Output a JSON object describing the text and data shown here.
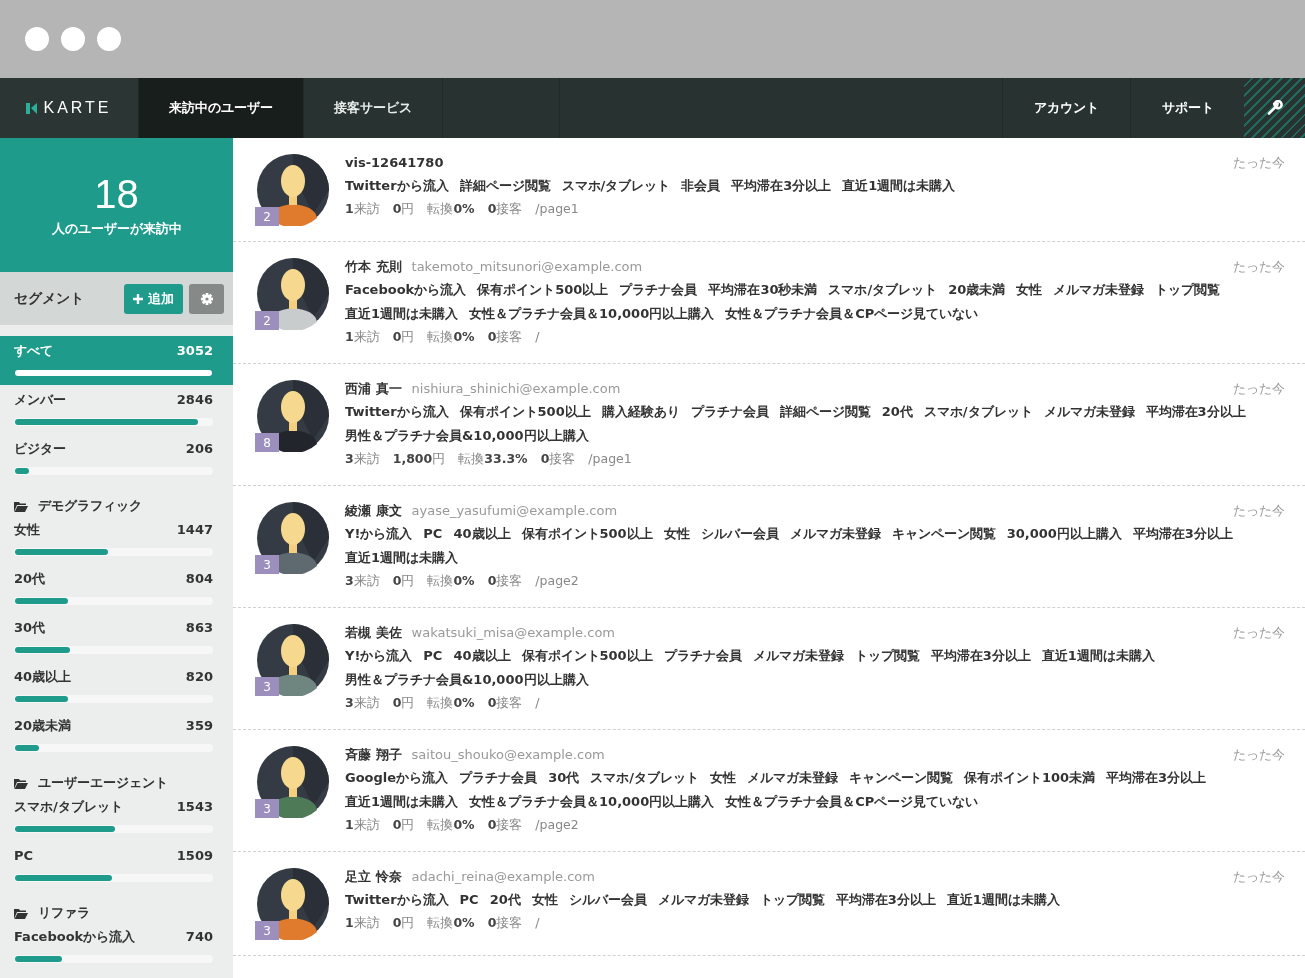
{
  "nav": {
    "logo": "KARTE",
    "tabs": [
      {
        "label": "来訪中のユーザー",
        "selected": true
      },
      {
        "label": "接客サービス",
        "selected": false
      }
    ],
    "right_links": [
      "アカウント",
      "サポート"
    ]
  },
  "summary": {
    "count": "18",
    "caption": "人のユーザーが来訪中"
  },
  "segments": {
    "title": "セグメント",
    "add_button": "追加",
    "items": [
      {
        "label": "すべて",
        "count": "3052",
        "level": 1,
        "selected": true
      },
      {
        "label": "メンバー",
        "count": "2846",
        "level": 0.93,
        "selected": false
      },
      {
        "label": "ビジター",
        "count": "206",
        "level": 0.07,
        "selected": false
      }
    ],
    "groups": [
      {
        "title": "デモグラフィック",
        "items": [
          {
            "label": "女性",
            "count": "1447",
            "level": 0.47,
            "selected": false
          },
          {
            "label": "20代",
            "count": "804",
            "level": 0.27,
            "selected": false
          },
          {
            "label": "30代",
            "count": "863",
            "level": 0.28,
            "selected": false
          },
          {
            "label": "40歳以上",
            "count": "820",
            "level": 0.27,
            "selected": false
          },
          {
            "label": "20歳未満",
            "count": "359",
            "level": 0.12,
            "selected": false
          }
        ]
      },
      {
        "title": "ユーザーエージェント",
        "items": [
          {
            "label": "スマホ/タブレット",
            "count": "1543",
            "level": 0.51,
            "selected": false
          },
          {
            "label": "PC",
            "count": "1509",
            "level": 0.49,
            "selected": false
          }
        ]
      },
      {
        "title": "リファラ",
        "items": [
          {
            "label": "Facebookから流入",
            "count": "740",
            "level": 0.24,
            "selected": false
          }
        ]
      }
    ]
  },
  "visitors": [
    {
      "badge": "2",
      "name": "vis-12641780",
      "time": "たった今",
      "color": "#e07a2c",
      "tags": [
        "Twitterから流入",
        "詳細ページ閲覧",
        "スマホ/タブレット",
        "非会員",
        "平均滞在3分以上",
        "直近1週間は未購入"
      ],
      "stats": [
        "**1**来訪",
        "**0**円",
        "転換**0%**",
        "**0**接客",
        "/page1"
      ]
    },
    {
      "badge": "2",
      "name": "竹本 充則",
      "email": "takemoto_mitsunori@example.com",
      "time": "たった今",
      "color": "#c9cccd",
      "tags": [
        "Facebookから流入",
        "保有ポイント500以上",
        "プラチナ会員",
        "平均滞在30秒未満",
        "スマホ/タブレット",
        "20歳未満",
        "女性",
        "メルマガ未登録",
        "トップ閲覧",
        "直近1週間は未購入",
        "女性＆プラチナ会員＆10,000円以上購入",
        "女性＆プラチナ会員＆CPページ見ていない"
      ],
      "stats": [
        "**1**来訪",
        "**0**円",
        "転換**0%**",
        "**0**接客",
        "/"
      ]
    },
    {
      "badge": "8",
      "name": "西浦 真一",
      "email": "nishiura_shinichi@example.com",
      "time": "たった今",
      "color": "#22262c",
      "tags": [
        "Twitterから流入",
        "保有ポイント500以上",
        "購入経験あり",
        "プラチナ会員",
        "詳細ページ閲覧",
        "20代",
        "スマホ/タブレット",
        "メルマガ未登録",
        "平均滞在3分以上",
        "男性＆プラチナ会員&10,000円以上購入"
      ],
      "stats": [
        "**3**来訪",
        "**1,800**円",
        "転換**33.3%**",
        "**0**接客",
        "/page1"
      ]
    },
    {
      "badge": "3",
      "name": "綾瀬 康文",
      "email": "ayase_yasufumi@example.com",
      "time": "たった今",
      "color": "#5f6a70",
      "tags": [
        "Y!から流入",
        "PC",
        "40歳以上",
        "保有ポイント500以上",
        "女性",
        "シルバー会員",
        "メルマガ未登録",
        "キャンペーン閲覧",
        "30,000円以上購入",
        "平均滞在3分以上",
        "直近1週間は未購入"
      ],
      "stats": [
        "**3**来訪",
        "**0**円",
        "転換**0%**",
        "**0**接客",
        "/page2"
      ]
    },
    {
      "badge": "3",
      "name": "若槻 美佐",
      "email": "wakatsuki_misa@example.com",
      "time": "たった今",
      "color": "#6f8580",
      "tags": [
        "Y!から流入",
        "PC",
        "40歳以上",
        "保有ポイント500以上",
        "プラチナ会員",
        "メルマガ未登録",
        "トップ閲覧",
        "平均滞在3分以上",
        "直近1週間は未購入",
        "男性＆プラチナ会員&10,000円以上購入"
      ],
      "stats": [
        "**3**来訪",
        "**0**円",
        "転換**0%**",
        "**0**接客",
        "/"
      ]
    },
    {
      "badge": "3",
      "name": "斉藤 翔子",
      "email": "saitou_shouko@example.com",
      "time": "たった今",
      "color": "#4f7a58",
      "tags": [
        "Googleから流入",
        "プラチナ会員",
        "30代",
        "スマホ/タブレット",
        "女性",
        "メルマガ未登録",
        "キャンペーン閲覧",
        "保有ポイント100未満",
        "平均滞在3分以上",
        "直近1週間は未購入",
        "女性＆プラチナ会員＆10,000円以上購入",
        "女性＆プラチナ会員＆CPページ見ていない"
      ],
      "stats": [
        "**1**来訪",
        "**0**円",
        "転換**0%**",
        "**0**接客",
        "/page2"
      ]
    },
    {
      "badge": "3",
      "name": "足立 怜奈",
      "email": "adachi_reina@example.com",
      "time": "たった今",
      "color": "#e07a2c",
      "tags": [
        "Twitterから流入",
        "PC",
        "20代",
        "女性",
        "シルバー会員",
        "メルマガ未登録",
        "トップ閲覧",
        "平均滞在3分以上",
        "直近1週間は未購入"
      ],
      "stats": [
        "**1**来訪",
        "**0**円",
        "転換**0%**",
        "**0**接客",
        "/"
      ]
    }
  ]
}
